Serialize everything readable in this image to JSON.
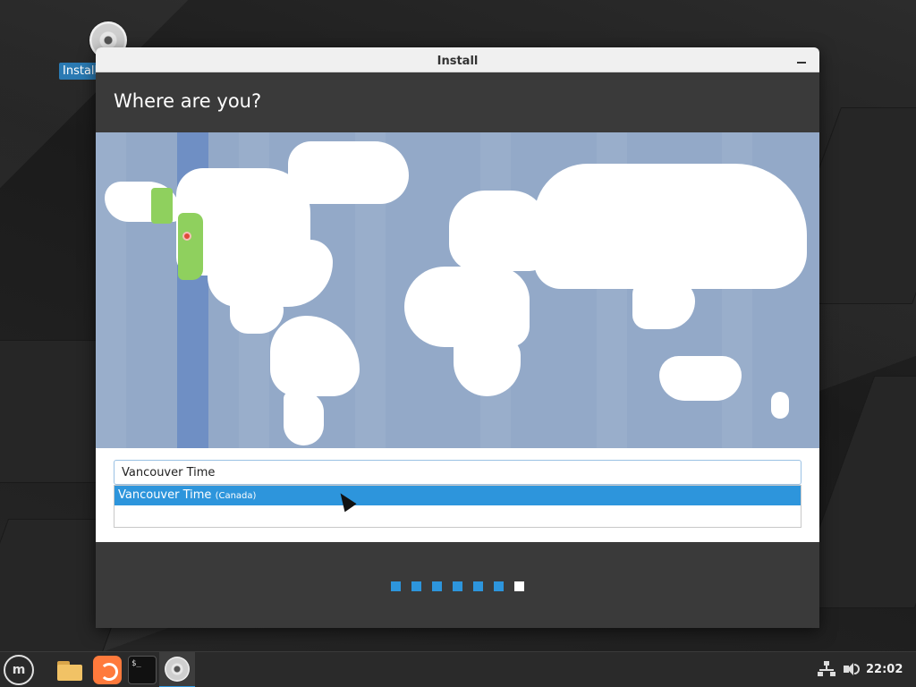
{
  "desktop": {
    "icon_label": "Install",
    "icon": "disc-icon"
  },
  "window": {
    "title": "Install",
    "header_title": "Where are you?",
    "minimize_icon": "minimize-icon"
  },
  "map": {
    "selected_timezone_color": "#6f8fc4",
    "region_color": "#8fd05e",
    "ocean_color": "#93a9c8",
    "pin_icon": "map-pin-icon"
  },
  "timezone": {
    "search_value": "Vancouver Time",
    "suggestions": [
      {
        "label": "Vancouver Time",
        "sublabel": "(Canada)"
      }
    ]
  },
  "progress": {
    "total_steps": 7,
    "current_step": 7,
    "active_color": "#2d95dc"
  },
  "taskbar": {
    "items": [
      "menu-icon",
      "folder-icon",
      "firefox-icon",
      "terminal-icon",
      "install-disc-icon"
    ],
    "terminal_glyph": "$_",
    "menu_glyph": "m",
    "tray": [
      "network-icon",
      "volume-icon"
    ],
    "clock": "22:02"
  }
}
